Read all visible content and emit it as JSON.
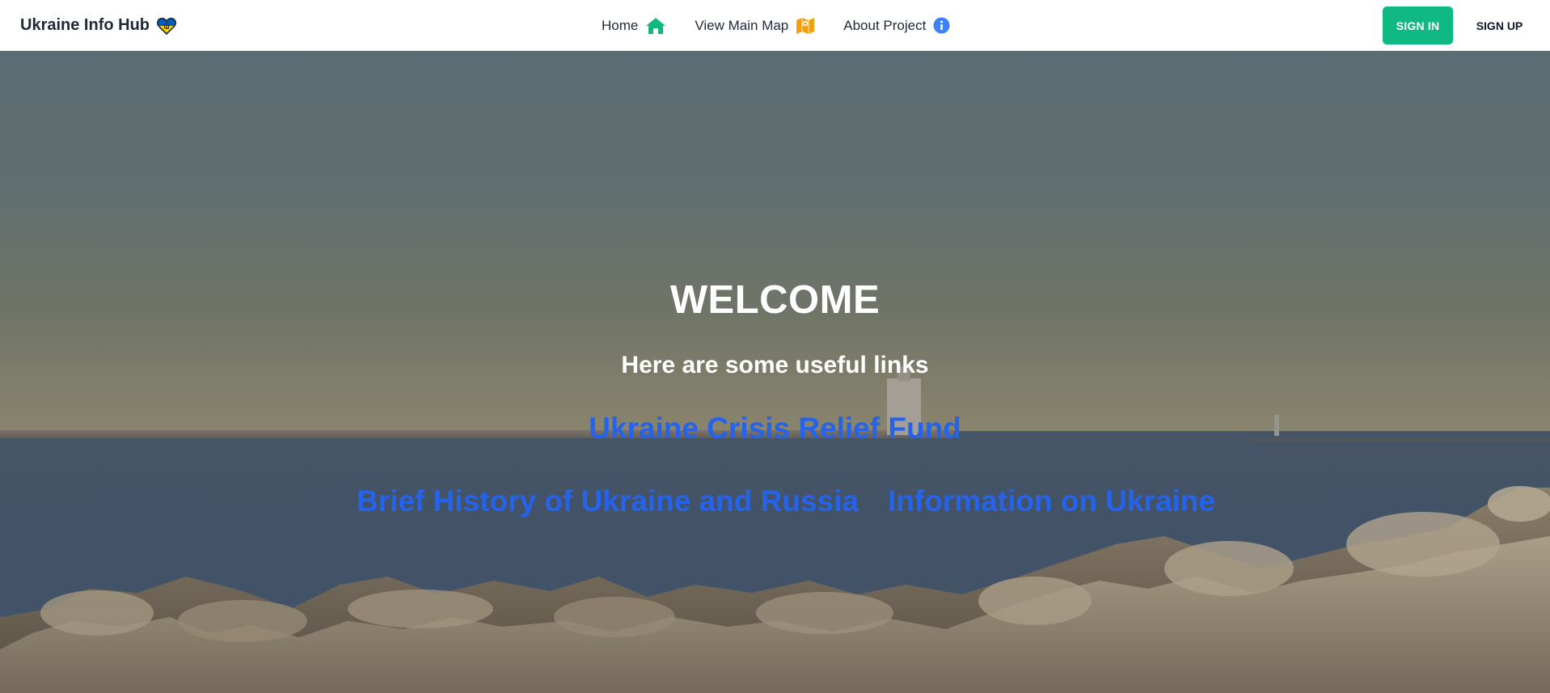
{
  "navbar": {
    "brand": "Ukraine Info Hub",
    "brand_icon": "ukraine-heart-icon",
    "links": [
      {
        "label": "Home",
        "icon": "home-icon",
        "color": "#10b981"
      },
      {
        "label": "View Main Map",
        "icon": "map-icon",
        "color": "#f59e0b"
      },
      {
        "label": "About Project",
        "icon": "info-icon",
        "color": "#3b82f6"
      }
    ],
    "sign_in": "SIGN IN",
    "sign_up": "SIGN UP"
  },
  "hero": {
    "title": "WELCOME",
    "subtitle": "Here are some useful links",
    "links": {
      "relief": "Ukraine Crisis Relief Fund",
      "history": "Brief History of Ukraine and Russia",
      "info": "Information on Ukraine"
    },
    "link_color": "#2563eb"
  },
  "colors": {
    "accent": "#10b981",
    "ukraine_blue": "#005bbb",
    "ukraine_yellow": "#ffd500"
  }
}
